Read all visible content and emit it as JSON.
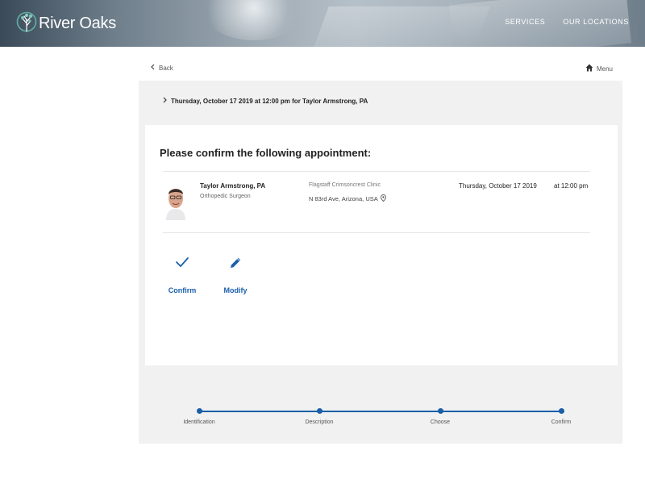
{
  "header": {
    "brand": "River Oaks",
    "nav": [
      {
        "label": "SERVICES"
      },
      {
        "label": "OUR LOCATIONS"
      }
    ]
  },
  "topbar": {
    "back_label": "Back",
    "menu_label": "Menu"
  },
  "summary": "Thursday, October 17 2019 at 12:00 pm for Taylor Armstrong, PA",
  "card": {
    "title": "Please confirm the following appointment:",
    "appointment": {
      "provider_name": "Taylor Armstrong, PA",
      "provider_title": "Orthopedic Surgeon",
      "clinic": "Flagstaff Crimsoncrest Clinic",
      "address": "N 83rd Ave, Arizona, USA",
      "date": "Thursday, October 17 2019",
      "time": "at 12:00 pm"
    },
    "actions": {
      "confirm": "Confirm",
      "modify": "Modify"
    }
  },
  "stepper": {
    "steps": [
      "Identification",
      "Description",
      "Choose",
      "Confirm"
    ],
    "progress": 1.0
  },
  "colors": {
    "accent": "#1a5fa8",
    "background": "#f1f1f1"
  }
}
